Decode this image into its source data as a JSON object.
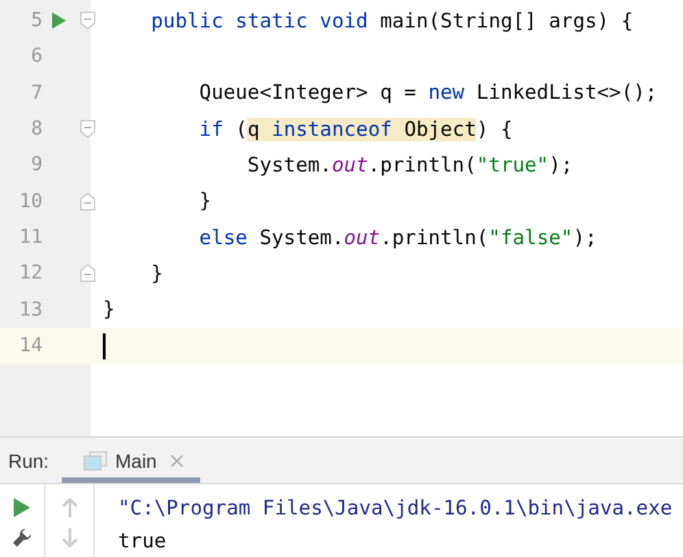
{
  "editor": {
    "lines": [
      {
        "number": "5",
        "run_marker": true,
        "fold": {
          "kind": "start"
        },
        "current": false,
        "tokens": [
          {
            "text": "    public",
            "kind": "keyword",
            "highlighted": false
          },
          {
            "text": " static",
            "kind": "keyword",
            "highlighted": false
          },
          {
            "text": " void",
            "kind": "keyword",
            "highlighted": false
          },
          {
            "text": " main(String[] args) {",
            "kind": "plain",
            "highlighted": false
          }
        ]
      },
      {
        "number": "6",
        "run_marker": false,
        "current": false
      },
      {
        "number": "7",
        "run_marker": false,
        "current": false,
        "tokens": [
          {
            "text": "        Queue<Integer> q = ",
            "kind": "plain",
            "highlighted": false
          },
          {
            "text": "new",
            "kind": "keyword",
            "highlighted": false
          },
          {
            "text": " LinkedList<>();",
            "kind": "plain",
            "highlighted": false
          }
        ]
      },
      {
        "number": "8",
        "run_marker": false,
        "fold": {
          "kind": "start"
        },
        "current": false,
        "tokens": [
          {
            "text": "        if",
            "kind": "keyword",
            "highlighted": false
          },
          {
            "text": " (",
            "kind": "plain",
            "highlighted": false
          },
          {
            "text": "q ",
            "kind": "plain",
            "highlighted": true
          },
          {
            "text": "instanceof",
            "kind": "keyword",
            "highlighted": true
          },
          {
            "text": " Object",
            "kind": "plain",
            "highlighted": true
          },
          {
            "text": ") {",
            "kind": "plain",
            "highlighted": false
          }
        ]
      },
      {
        "number": "9",
        "run_marker": false,
        "current": false,
        "tokens": [
          {
            "text": "            System.",
            "kind": "plain",
            "highlighted": false
          },
          {
            "text": "out",
            "kind": "static_field",
            "highlighted": false
          },
          {
            "text": ".println(",
            "kind": "plain",
            "highlighted": false
          },
          {
            "text": "\"true\"",
            "kind": "string",
            "highlighted": false
          },
          {
            "text": ");",
            "kind": "plain",
            "highlighted": false
          }
        ]
      },
      {
        "number": "10",
        "run_marker": false,
        "fold": {
          "kind": "end"
        },
        "current": false,
        "tokens": [
          {
            "text": "        }",
            "kind": "plain",
            "highlighted": false
          }
        ]
      },
      {
        "number": "11",
        "run_marker": false,
        "current": false,
        "tokens": [
          {
            "text": "        else",
            "kind": "keyword",
            "highlighted": false
          },
          {
            "text": " System.",
            "kind": "plain",
            "highlighted": false
          },
          {
            "text": "out",
            "kind": "static_field",
            "highlighted": false
          },
          {
            "text": ".println(",
            "kind": "plain",
            "highlighted": false
          },
          {
            "text": "\"false\"",
            "kind": "string",
            "highlighted": false
          },
          {
            "text": ");",
            "kind": "plain",
            "highlighted": false
          }
        ]
      },
      {
        "number": "12",
        "run_marker": false,
        "fold": {
          "kind": "end"
        },
        "current": false,
        "tokens": [
          {
            "text": "    }",
            "kind": "plain",
            "highlighted": false
          }
        ]
      },
      {
        "number": "13",
        "run_marker": false,
        "current": false,
        "tokens": [
          {
            "text": "}",
            "kind": "plain",
            "highlighted": false
          }
        ]
      },
      {
        "number": "14",
        "run_marker": false,
        "current": true
      }
    ]
  },
  "run_panel": {
    "label": "Run:",
    "tabs": [
      {
        "label": "Main",
        "selected": true,
        "closable": true
      }
    ],
    "tools": [
      {
        "kind": "run",
        "disabled": false
      },
      {
        "kind": "up",
        "disabled": true
      },
      {
        "kind": "settings",
        "disabled": false
      },
      {
        "kind": "down",
        "disabled": true
      }
    ],
    "console": [
      {
        "text": "\"C:\\Program Files\\Java\\jdk-16.0.1\\bin\\java.exe",
        "kind": "command"
      },
      {
        "text": "true",
        "kind": "output"
      }
    ]
  }
}
